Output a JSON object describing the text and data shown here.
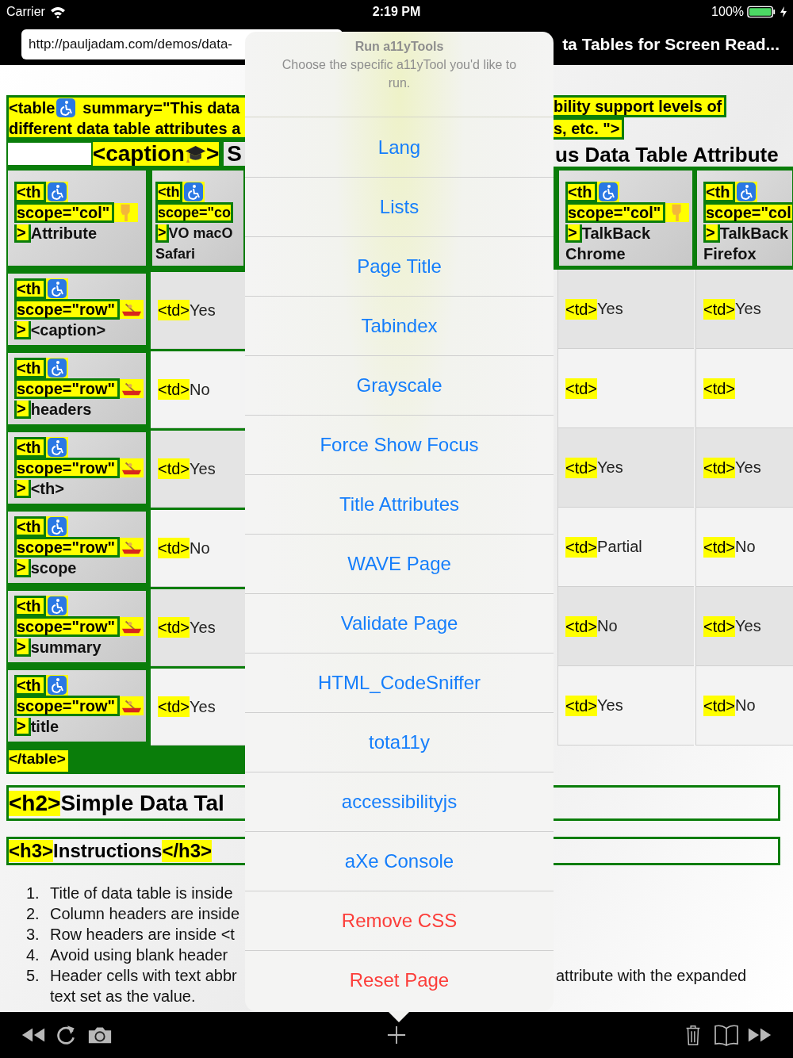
{
  "status_bar": {
    "carrier": "Carrier",
    "time": "2:19 PM",
    "battery": "100%"
  },
  "browser": {
    "url": "http://pauljadam.com/demos/data-",
    "page_title": "ta Tables for Screen Read..."
  },
  "summary": {
    "tag": "<table",
    "left_lines": [
      "summary=\"This data",
      "different data table attributes a"
    ],
    "right_lines": [
      "bility support levels of",
      "s, etc. \">"
    ]
  },
  "caption": {
    "tag": "<caption",
    "close": ">",
    "left_text": "S",
    "right_text": "us Data Table Attribute"
  },
  "columns_left": [
    {
      "tag": "<th",
      "attr": "scope=\"col\"",
      "close": ">",
      "lines": [
        "Attribute"
      ]
    },
    {
      "tag": "<th",
      "attr": "scope=\"co",
      "close": ">",
      "lines": [
        "VO macO",
        "Safari"
      ]
    }
  ],
  "columns_right": [
    {
      "tag": "<th",
      "attr": "scope=\"col\"",
      "close": ">",
      "lines": [
        "TalkBack",
        "Chrome"
      ]
    },
    {
      "tag": "<th",
      "attr": "scope=\"col",
      "close": ">",
      "lines": [
        "TalkBack",
        "Firefox"
      ]
    }
  ],
  "rows": [
    {
      "header": {
        "tag": "<th",
        "attr": "scope=\"row\"",
        "close": ">",
        "lines": [
          "<caption>"
        ]
      },
      "cells_left": [
        {
          "tag": "<td>",
          "value": "Yes"
        }
      ],
      "cells_right": [
        {
          "tag": "<td>",
          "value": "Yes"
        },
        {
          "tag": "<td>",
          "value": "Yes"
        }
      ]
    },
    {
      "header": {
        "tag": "<th",
        "attr": "scope=\"row\"",
        "close": ">",
        "lines": [
          "headers"
        ]
      },
      "cells_left": [
        {
          "tag": "<td>",
          "value": "No"
        }
      ],
      "cells_right": [
        {
          "tag": "<td>"
        },
        {
          "tag": "<td>"
        }
      ]
    },
    {
      "header": {
        "tag": "<th",
        "attr": "scope=\"row\"",
        "close": ">",
        "lines": [
          "<th>"
        ]
      },
      "cells_left": [
        {
          "tag": "<td>",
          "value": "Yes"
        }
      ],
      "cells_right": [
        {
          "tag": "<td>",
          "value": "Yes"
        },
        {
          "tag": "<td>",
          "value": "Yes"
        }
      ]
    },
    {
      "header": {
        "tag": "<th",
        "attr": "scope=\"row\"",
        "close": ">",
        "lines": [
          "scope"
        ]
      },
      "cells_left": [
        {
          "tag": "<td>",
          "value": "No"
        }
      ],
      "cells_right": [
        {
          "tag": "<td>",
          "value": "Partial"
        },
        {
          "tag": "<td>",
          "value": "No"
        }
      ]
    },
    {
      "header": {
        "tag": "<th",
        "attr": "scope=\"row\"",
        "close": ">",
        "lines": [
          "summary"
        ]
      },
      "cells_left": [
        {
          "tag": "<td>",
          "value": "Yes"
        }
      ],
      "cells_right": [
        {
          "tag": "<td>",
          "value": "No"
        },
        {
          "tag": "<td>",
          "value": "Yes"
        }
      ]
    },
    {
      "header": {
        "tag": "<th",
        "attr": "scope=\"row\"",
        "close": ">",
        "lines": [
          "title"
        ]
      },
      "cells_left": [
        {
          "tag": "<td>",
          "value": "Yes"
        }
      ],
      "cells_right": [
        {
          "tag": "<td>",
          "value": "Yes"
        },
        {
          "tag": "<td>",
          "value": "No"
        }
      ]
    }
  ],
  "table_close": "</table>",
  "h2": {
    "tag": "<h2>",
    "text": "Simple Data Tal"
  },
  "h3": {
    "tag": "<h3>",
    "text": "Instructions",
    "close": "</h3>"
  },
  "instructions": [
    {
      "number": "1.",
      "lines": [
        "Title of data table is inside"
      ]
    },
    {
      "number": "2.",
      "lines": [
        "Column headers are inside"
      ]
    },
    {
      "number": "3.",
      "lines": [
        "Row headers are inside <t"
      ]
    },
    {
      "number": "4.",
      "lines": [
        "Avoid using blank header"
      ]
    },
    {
      "number": "5.",
      "lines": [
        "Header cells with text abbr",
        "text set as the value."
      ]
    }
  ],
  "instructions_right": [
    "attribute with the expanded"
  ],
  "popover": {
    "title": "Run a11yTools",
    "subtitle": "Choose the specific a11yTool you'd like to run.",
    "actions": [
      {
        "label": "Lang",
        "kind": "default"
      },
      {
        "label": "Lists",
        "kind": "default"
      },
      {
        "label": "Page Title",
        "kind": "default"
      },
      {
        "label": "Tabindex",
        "kind": "default"
      },
      {
        "label": "Grayscale",
        "kind": "default"
      },
      {
        "label": "Force Show Focus",
        "kind": "default"
      },
      {
        "label": "Title Attributes",
        "kind": "default"
      },
      {
        "label": "WAVE Page",
        "kind": "default"
      },
      {
        "label": "Validate Page",
        "kind": "default"
      },
      {
        "label": "HTML_CodeSniffer",
        "kind": "default"
      },
      {
        "label": "tota11y",
        "kind": "default"
      },
      {
        "label": "accessibilityjs",
        "kind": "default"
      },
      {
        "label": "aXe Console",
        "kind": "default"
      },
      {
        "label": "Remove CSS",
        "kind": "destructive"
      },
      {
        "label": "Reset Page",
        "kind": "destructive"
      }
    ]
  }
}
